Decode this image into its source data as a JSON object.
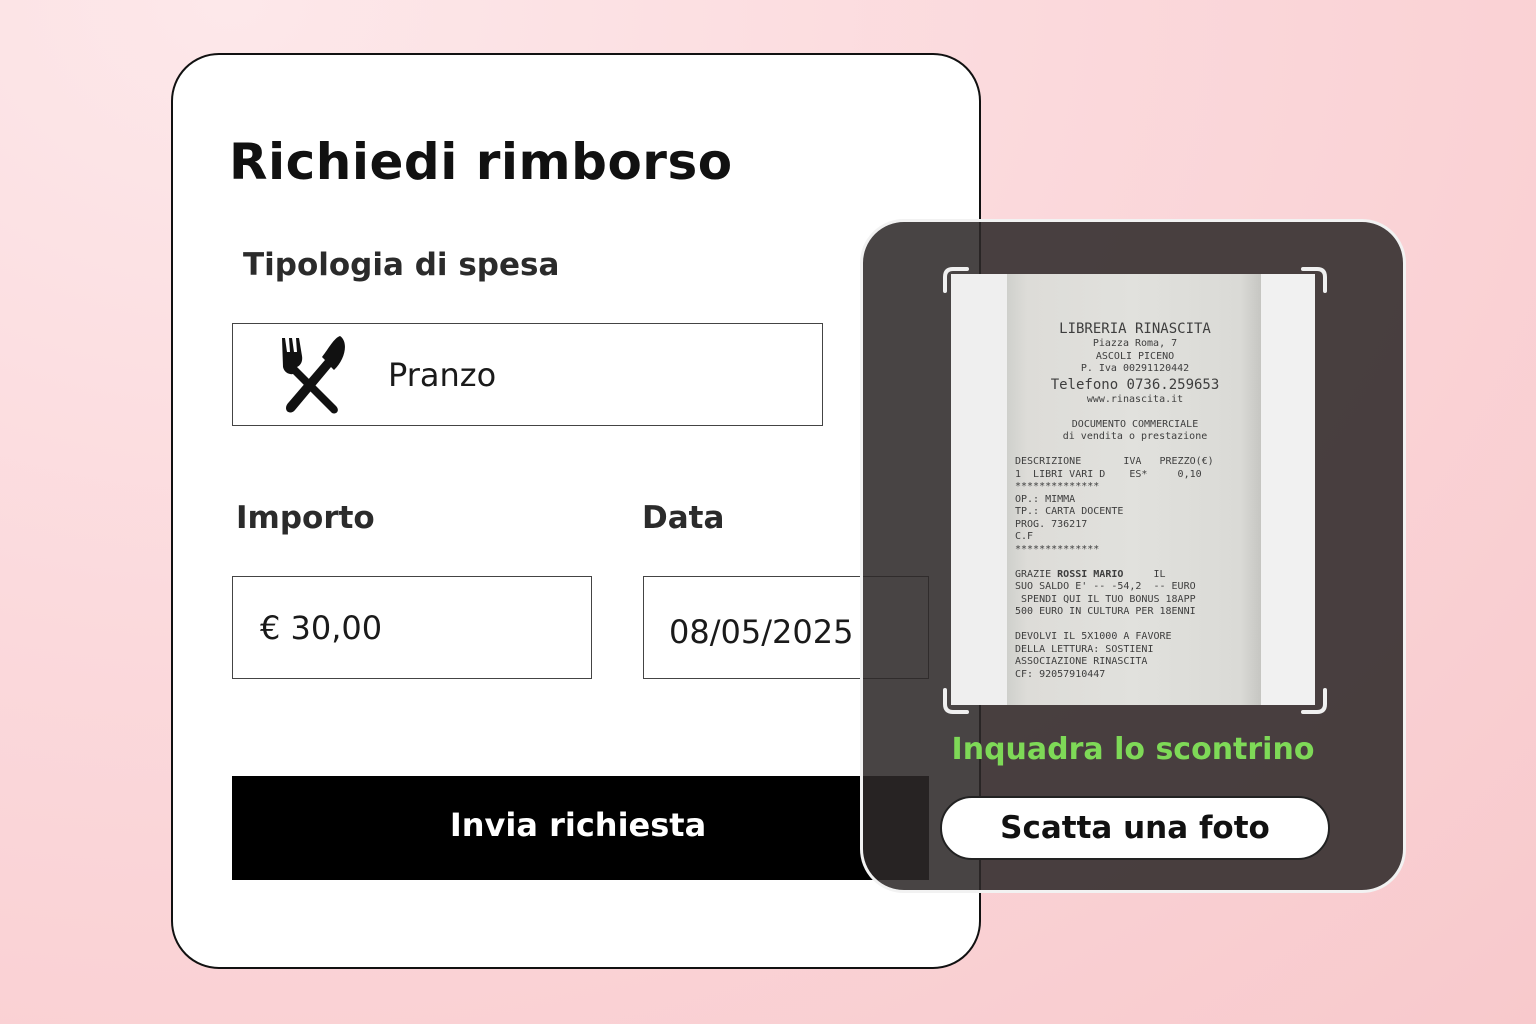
{
  "form": {
    "title": "Richiedi rimborso",
    "expense_type_label": "Tipologia di spesa",
    "expense_type_value": "Pranzo",
    "expense_type_icon": "fork-knife-icon",
    "amount_label": "Importo",
    "amount_value": "€ 30,00",
    "date_label": "Data",
    "date_value": "08/05/2025",
    "submit_label": "Invia richiesta"
  },
  "camera": {
    "hint": "Inquadra lo scontrino",
    "hint_color": "#7ed957",
    "capture_label": "Scatta una foto",
    "receipt": {
      "store": "LIBRERIA RINASCITA",
      "address1": "Piazza Roma, 7",
      "address2": "ASCOLI PICENO",
      "vat": "P. Iva 00291120442",
      "phone": "Telefono 0736.259653",
      "web": "www.rinascita.it",
      "doc1": "DOCUMENTO COMMERCIALE",
      "doc2": "di vendita o prestazione",
      "header": "DESCRIZIONE       IVA   PREZZO(€)",
      "item": "1  LIBRI VARI D    ES*     0,10",
      "stars1": "**************",
      "op": "OP.: MIMMA",
      "tp": "TP.: CARTA DOCENTE",
      "prog": "PROG. 736217",
      "cf": "C.F",
      "stars2": "**************",
      "thanks_pre": "GRAZIE ",
      "thanks_name": "ROSSI MARIO",
      "thanks_post": "     IL",
      "line2": "SUO SALDO E' -- -54,2  -- EURO",
      "line3": " SPENDI QUI IL TUO BONUS 18APP",
      "line4": "500 EURO IN CULTURA PER 18ENNI",
      "dev1": "DEVOLVI IL 5X1000 A FAVORE",
      "dev2": "DELLA LETTURA: SOSTIENI",
      "dev3": "ASSOCIAZIONE RINASCITA",
      "dev4": "CF: 92057910447"
    }
  }
}
